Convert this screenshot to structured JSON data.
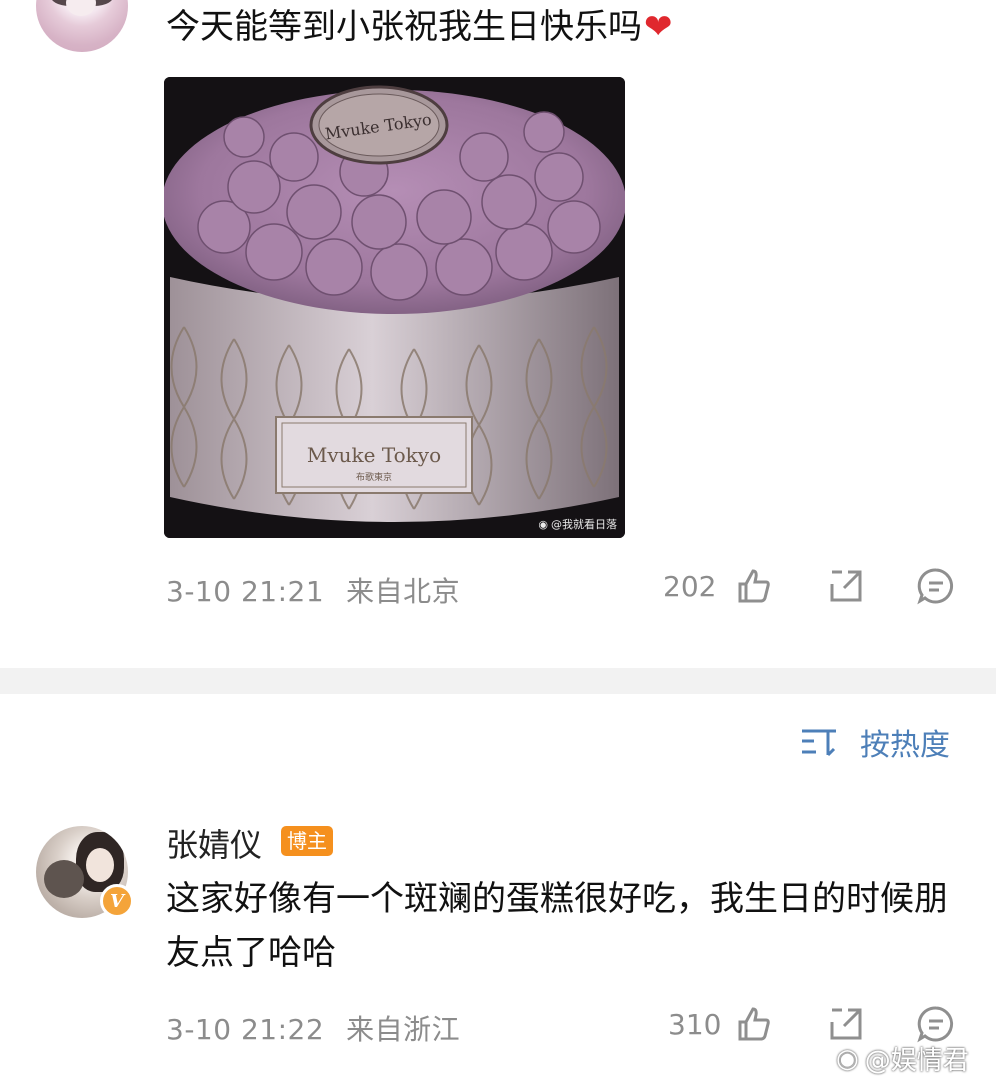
{
  "post": {
    "text": "今天能等到小张祝我生日快乐吗",
    "emoji": "❤",
    "photo": {
      "box_label_brand": "Mvuke Tokyo",
      "box_label_sub": "布歌東京",
      "top_disc_label": "Mvuke Tokyo",
      "watermark": "@我就看日落"
    },
    "time": "3-10 21:21",
    "location": "来自北京",
    "like_count": "202"
  },
  "sort": {
    "label": "按热度",
    "icon": "sort-icon"
  },
  "reply": {
    "username": "张婧仪",
    "badge": "博主",
    "verified": "V",
    "text": "这家好像有一个斑斓的蛋糕很好吃，我生日的时候朋友点了哈哈",
    "time": "3-10 21:22",
    "location": "来自浙江",
    "like_count": "310"
  },
  "corner_watermark": "@娱情君",
  "colors": {
    "link_blue": "#4d7fb8",
    "meta_grey": "#8c8c8c",
    "badge_orange": "#f5901e",
    "verified_orange": "#f4a43a",
    "heart_red": "#e0282e"
  }
}
